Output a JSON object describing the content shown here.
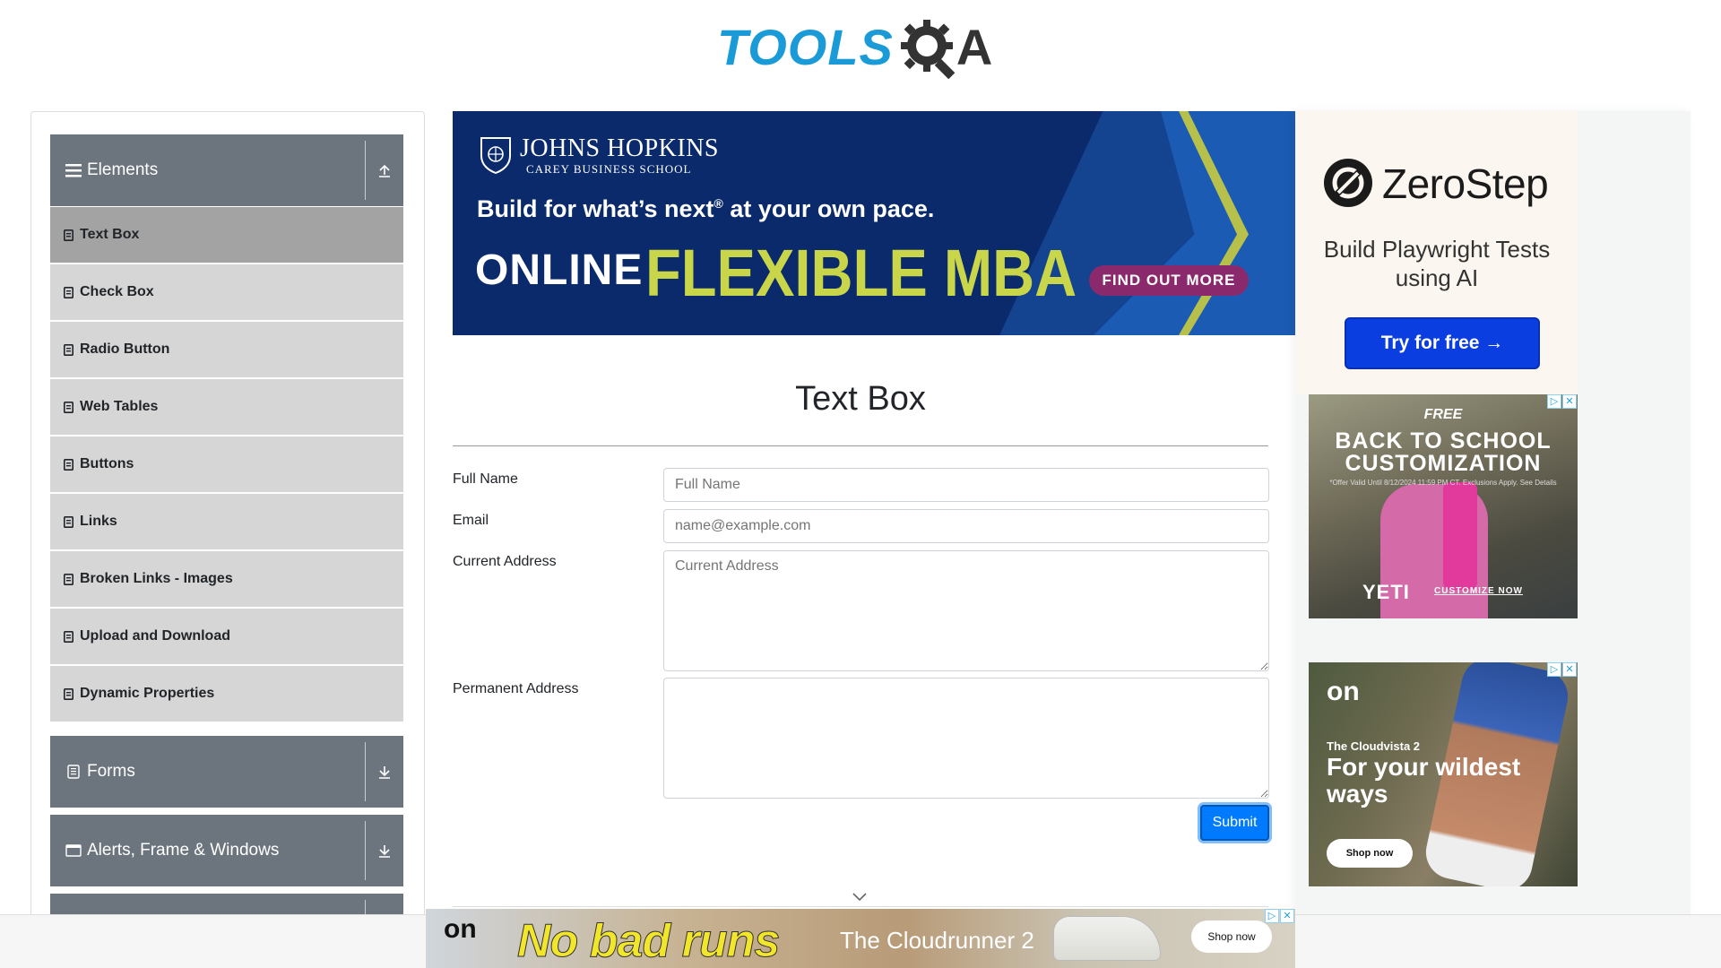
{
  "header": {
    "logo_tools": "TOOLS",
    "logo_qa": "A"
  },
  "sidebar": {
    "groups": [
      {
        "label": "Elements",
        "expanded": true
      },
      {
        "label": "Forms",
        "expanded": false
      },
      {
        "label": "Alerts, Frame & Windows",
        "expanded": false
      }
    ],
    "items": [
      {
        "label": "Text Box",
        "active": true
      },
      {
        "label": "Check Box"
      },
      {
        "label": "Radio Button"
      },
      {
        "label": "Web Tables"
      },
      {
        "label": "Buttons"
      },
      {
        "label": "Links"
      },
      {
        "label": "Broken Links - Images"
      },
      {
        "label": "Upload and Download"
      },
      {
        "label": "Dynamic Properties"
      }
    ]
  },
  "top_ad": {
    "school": "JOHNS HOPKINS",
    "school_sub": "CAREY BUSINESS SCHOOL",
    "tagline": "Build for what’s next",
    "tagline_mark": "®",
    "tagline_end": " at your own pace.",
    "online": "ONLINE",
    "program": "FLEXIBLE MBA",
    "cta": "FIND OUT MORE"
  },
  "form": {
    "title": "Text Box",
    "fields": [
      {
        "label": "Full Name",
        "placeholder": "Full Name",
        "value": ""
      },
      {
        "label": "Email",
        "placeholder": "name@example.com",
        "value": ""
      },
      {
        "label": "Current Address",
        "placeholder": "Current Address",
        "value": ""
      },
      {
        "label": "Permanent Address",
        "placeholder": "",
        "value": ""
      }
    ],
    "submit_label": "Submit"
  },
  "right_ads": {
    "zerostep": {
      "brand": "ZeroStep",
      "text": "Build Playwright Tests using AI",
      "cta": "Try for free →"
    },
    "yeti": {
      "free": "FREE",
      "headline": "BACK TO SCHOOL CUSTOMIZATION",
      "fine_print": "*Offer Valid Until 8/12/2024 11:59 PM CT. Exclusions Apply. See Details",
      "brand": "YETI",
      "cta": "CUSTOMIZE NOW"
    },
    "on": {
      "logo": "on",
      "product": "The Cloudvista 2",
      "headline": "For your wildest ways",
      "cta": "Shop now"
    }
  },
  "bottom_ad": {
    "logo": "on",
    "headline": "No bad runs",
    "product": "The Cloudrunner 2",
    "cta": "Shop now"
  },
  "adchoices": {
    "info": "▷",
    "close": "✕"
  },
  "colors": {
    "group_header": "#6c757d",
    "menu_item": "#d6d6d6",
    "menu_item_active": "#a3a3a3",
    "submit": "#007bff",
    "logo_blue": "#1a9bd7"
  }
}
